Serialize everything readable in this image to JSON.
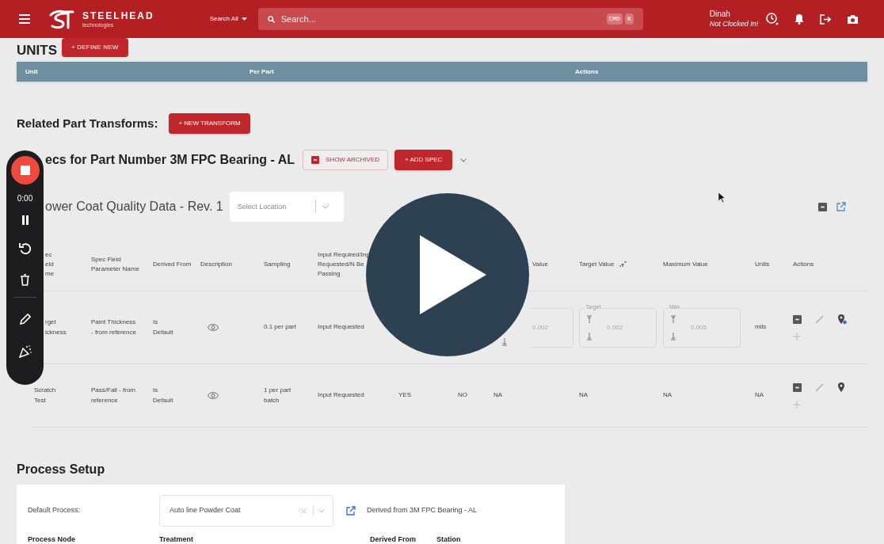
{
  "top_bar": {
    "logo_name": "STEELHEAD",
    "logo_tagline": "technologies",
    "search_scope": "Search All",
    "search": {
      "placeholder": "Search..."
    },
    "shortcut_keys": [
      "CMD",
      "K"
    ],
    "user_name": "Dinah",
    "clock_status": "Not Clocked In!"
  },
  "units": {
    "title": "UNITS",
    "define_button": "+ DEFINE NEW",
    "columns": [
      "Unit",
      "Per Part",
      "Actions"
    ]
  },
  "related_transforms": {
    "title": "Related Part Transforms:",
    "button": "+ NEW TRANSFORM"
  },
  "specs": {
    "title": "ecs for Part Number 3M FPC Bearing - AL",
    "show_archived_button": "SHOW ARCHIVED",
    "add_spec_button": "+ ADD SPEC"
  },
  "spec_group": {
    "title": "ower Coat Quality Data - Rev. 1",
    "location": {
      "placeholder": "Select Location"
    }
  },
  "spec_table": {
    "columns": [
      {
        "kind": "text",
        "label": "ec eld me"
      },
      {
        "kind": "text",
        "label": "Spec Field Parameter Name"
      },
      {
        "kind": "text",
        "label": "Derived From"
      },
      {
        "kind": "text",
        "label": "Description"
      },
      {
        "kind": "text",
        "label": "Sampling"
      },
      {
        "kind": "text",
        "label": "Input Required/Inp Requested/N Be Passing"
      },
      {
        "kind": "covered"
      },
      {
        "kind": "covered"
      },
      {
        "kind": "cut_text",
        "label": "Value"
      },
      {
        "kind": "sortable",
        "label": "Target Value"
      },
      {
        "kind": "text",
        "label": "Maximum Value"
      },
      {
        "kind": "text",
        "label": "Units"
      },
      {
        "kind": "text",
        "label": "Actions"
      }
    ],
    "rows": [
      {
        "cells": [
          {
            "kind": "text",
            "text": "rget ickness"
          },
          {
            "kind": "text",
            "text": "Paint Thickness - from reference"
          },
          {
            "kind": "text",
            "text": "Is Default"
          },
          {
            "kind": "eye"
          },
          {
            "kind": "text",
            "text": "0.1 per part"
          },
          {
            "kind": "text",
            "text": "Input Requested"
          },
          {
            "kind": "covered"
          },
          {
            "kind": "covered"
          },
          {
            "kind": "field_cut",
            "value": "0.002"
          },
          {
            "kind": "field",
            "label": "Target",
            "value": "0.002"
          },
          {
            "kind": "field",
            "label": "Max",
            "value": "0.005"
          },
          {
            "kind": "text",
            "text": "mils"
          },
          {
            "kind": "actions",
            "location_set": true
          }
        ]
      },
      {
        "cells": [
          {
            "kind": "text",
            "text": "Scratch Test"
          },
          {
            "kind": "text",
            "text": "Pass/Fail - from reference"
          },
          {
            "kind": "text",
            "text": "Is Default"
          },
          {
            "kind": "eye"
          },
          {
            "kind": "text",
            "text": "1 per part batch"
          },
          {
            "kind": "text",
            "text": "Input Requested"
          },
          {
            "kind": "text",
            "text": "YES"
          },
          {
            "kind": "text",
            "text": "NO"
          },
          {
            "kind": "text",
            "text": "NA"
          },
          {
            "kind": "text",
            "text": "NA"
          },
          {
            "kind": "text",
            "text": "NA"
          },
          {
            "kind": "text",
            "text": "NA"
          },
          {
            "kind": "actions",
            "location_set": false
          }
        ]
      }
    ]
  },
  "process_setup": {
    "title": "Process Setup",
    "default_label": "Default Process:",
    "process_value": "Auto line Powder Coat",
    "derived_note": "Derived from 3M FPC Bearing - AL",
    "columns": [
      "Process Node",
      "Treatment",
      "Derived From",
      "Station"
    ]
  },
  "recorder": {
    "timer": "0:00"
  }
}
